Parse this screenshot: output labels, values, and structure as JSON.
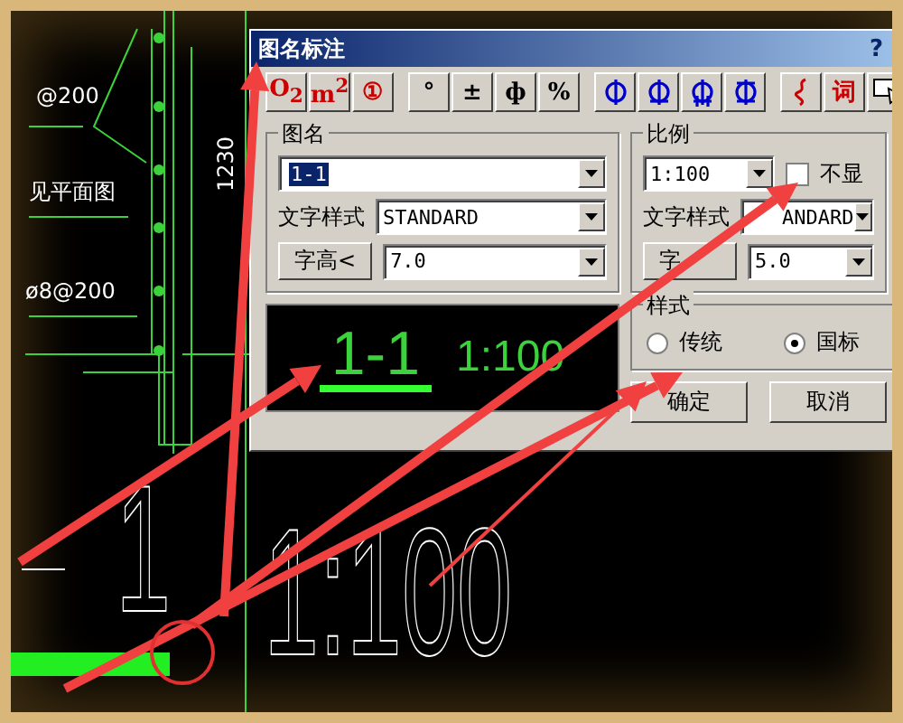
{
  "cad_drawing": {
    "labels": [
      {
        "kind": "horizontal",
        "text": "@200"
      },
      {
        "kind": "horizontal",
        "text": "见平面图"
      },
      {
        "kind": "horizontal",
        "text": "ø8@200"
      },
      {
        "kind": "vertical",
        "text": "1230"
      }
    ],
    "big_texts": [
      "1",
      "1:100"
    ]
  },
  "dialog": {
    "title": "图名标注",
    "help": "?",
    "toolbar": [
      [
        {
          "kind": "text",
          "label": "O$_{2}$",
          "color": "#cc0000"
        },
        {
          "kind": "text",
          "label": "m$^{2}$",
          "color": "#cc0000"
        },
        {
          "kind": "text",
          "label": "①",
          "color": "#cc0000"
        }
      ],
      [
        {
          "kind": "text",
          "label": "°",
          "color": "#000000"
        },
        {
          "kind": "text",
          "label": "±",
          "color": "#000000"
        },
        {
          "kind": "text",
          "label": "ф",
          "color": "#000000"
        },
        {
          "kind": "text",
          "label": "%",
          "color": "#000000"
        }
      ],
      [
        {
          "kind": "rebar"
        },
        {
          "kind": "rebar"
        },
        {
          "kind": "rebar"
        },
        {
          "kind": "rebar"
        }
      ],
      [
        {
          "kind": "squiggle"
        },
        {
          "kind": "text",
          "label": "词",
          "color": "#cc0000"
        },
        {
          "kind": "pointer"
        }
      ]
    ],
    "name_group": {
      "legend": "图名",
      "name_combo": {
        "value": "1-1",
        "highlighted": true
      },
      "style_label": "文字样式",
      "style_combo": "STANDARD",
      "height_button": "字高<",
      "height_combo": "7.0"
    },
    "preview": {
      "name": "1-1",
      "scale": "1:100"
    },
    "scale_group": {
      "legend": "比例",
      "scale_combo": "1:100",
      "hide_checkbox": {
        "label": "不显",
        "checked": false
      },
      "style_label": "文字样式",
      "style_combo": "ANDARD",
      "height_button": "字",
      "height_combo": "5.0"
    },
    "style_group": {
      "legend": "样式",
      "options": [
        {
          "label": "传统",
          "selected": false
        },
        {
          "label": "国标",
          "selected": true
        }
      ]
    },
    "buttons": [
      "确定",
      "取消"
    ]
  }
}
